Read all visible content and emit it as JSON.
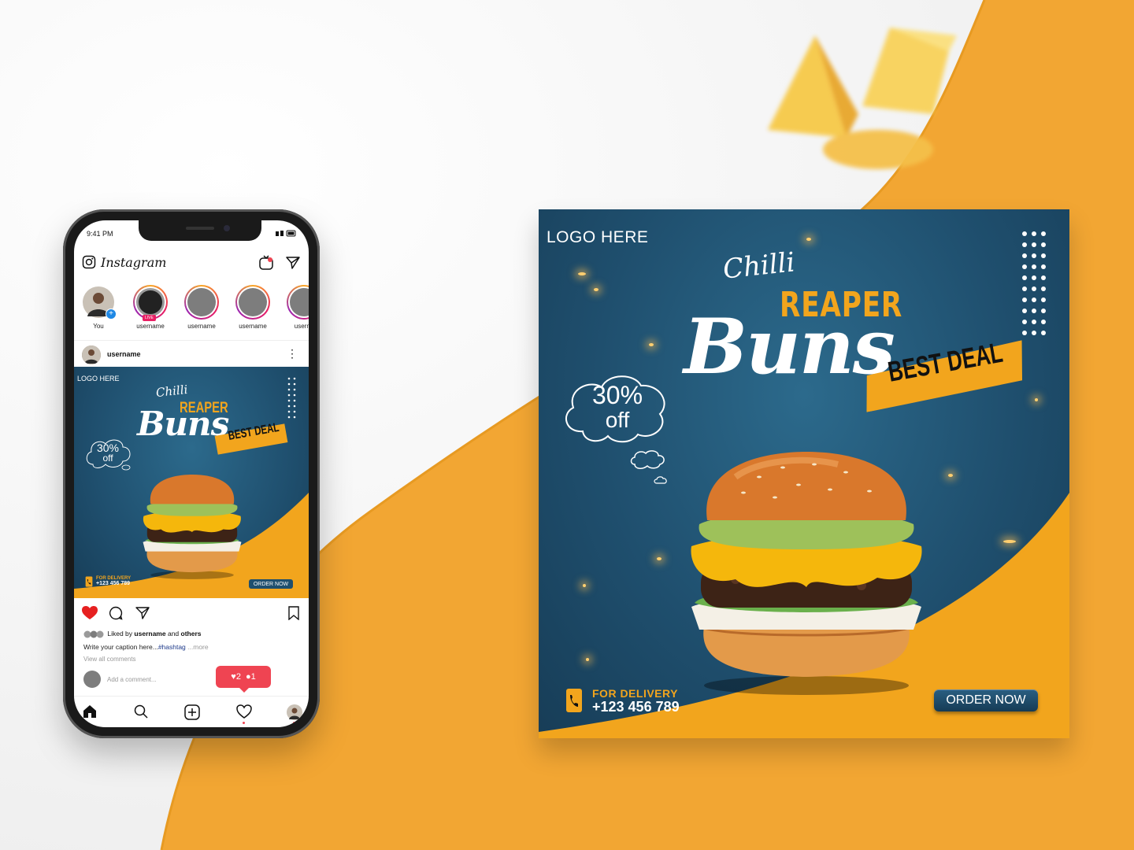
{
  "phone": {
    "status_time": "9:41 PM",
    "app_title": "Instagram",
    "stories": [
      {
        "name": "You",
        "live": false
      },
      {
        "name": "username",
        "live": true
      },
      {
        "name": "username",
        "live": false
      },
      {
        "name": "username",
        "live": false
      },
      {
        "name": "userna",
        "live": false
      }
    ],
    "live_label": "LIVE",
    "post_username": "username",
    "post": {
      "logo": "LOGO HERE",
      "chilli": "Chilli",
      "reaper": "REAPER",
      "buns": "Buns",
      "best_deal": "BEST DEAL",
      "discount_pct": "30%",
      "discount_off": "off",
      "delivery_label": "FOR DELIVERY",
      "phone": "+123 456 789",
      "order": "ORDER NOW"
    },
    "liked_prefix": "Liked by",
    "liked_user": "username",
    "liked_and": "and",
    "liked_others": "others",
    "caption_text": "Write your caption here...",
    "caption_tag": "#hashtag",
    "caption_more": " ...more",
    "view_all": "View all comments",
    "comment_placeholder": "Add a comment...",
    "notif_likes": "2",
    "notif_comments": "1"
  },
  "big_post": {
    "logo": "LOGO HERE",
    "chilli": "Chilli",
    "reaper": "REAPER",
    "buns": "Buns",
    "best_deal": "BEST DEAL",
    "discount_pct": "30%",
    "discount_off": "off",
    "delivery_label": "FOR DELIVERY",
    "phone": "+123 456 789",
    "order": "ORDER NOW"
  },
  "colors": {
    "orange": "#f2a51d",
    "navy": "#1f4f6e",
    "like_red": "#ef4452"
  }
}
